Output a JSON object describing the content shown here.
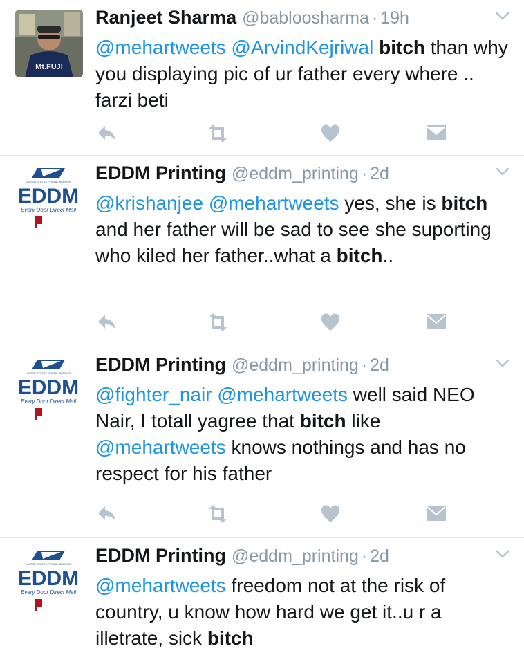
{
  "colors": {
    "mention": "#1b95e0",
    "meta": "#8899a6",
    "action_icon": "#b7c4d0",
    "divider": "#e1e8ed",
    "eddm_blue": "#1d4f91",
    "eddm_red": "#b0141c"
  },
  "eddm_logo": {
    "wordmark": "EDDM",
    "tagline": "Every Door Direct Mail",
    "usps": "UNITED STATES POSTAL SERVICE"
  },
  "tweets": [
    {
      "name": "Ranjeet Sharma",
      "handle": "@babloosharma",
      "dot": "·",
      "time": "19h",
      "avatar_caption": "Mt.FUJI",
      "segments": [
        {
          "t": "@mehartweets",
          "s": "mention"
        },
        {
          "t": " ",
          "s": ""
        },
        {
          "t": "@ArvindKejriwal",
          "s": "mention"
        },
        {
          "t": " ",
          "s": ""
        },
        {
          "t": "bitch",
          "s": "bold"
        },
        {
          "t": " than why you displaying pic of ur father every where .. farzi beti",
          "s": ""
        }
      ]
    },
    {
      "name": "EDDM Printing",
      "handle": "@eddm_printing",
      "dot": "·",
      "time": "2d",
      "segments": [
        {
          "t": "@krishanjee",
          "s": "mention"
        },
        {
          "t": " ",
          "s": ""
        },
        {
          "t": "@mehartweets",
          "s": "mention"
        },
        {
          "t": " yes, she is ",
          "s": ""
        },
        {
          "t": "bitch",
          "s": "bold"
        },
        {
          "t": " and her father will be sad to see she suporting who kiled her father..what a ",
          "s": ""
        },
        {
          "t": "bitch",
          "s": "bold"
        },
        {
          "t": "..",
          "s": ""
        }
      ]
    },
    {
      "name": "EDDM Printing",
      "handle": "@eddm_printing",
      "dot": "·",
      "time": "2d",
      "segments": [
        {
          "t": "@fighter_nair",
          "s": "mention"
        },
        {
          "t": " ",
          "s": ""
        },
        {
          "t": "@mehartweets",
          "s": "mention"
        },
        {
          "t": " well said NEO Nair, I totall yagree that ",
          "s": ""
        },
        {
          "t": "bitch",
          "s": "bold"
        },
        {
          "t": " like ",
          "s": ""
        },
        {
          "t": "@mehartweets",
          "s": "mention"
        },
        {
          "t": " knows nothings and has no respect for his father",
          "s": ""
        }
      ]
    },
    {
      "name": "EDDM Printing",
      "handle": "@eddm_printing",
      "dot": "·",
      "time": "2d",
      "segments": [
        {
          "t": "@mehartweets",
          "s": "mention"
        },
        {
          "t": " freedom not at the risk of country, u know how hard we get it..u r a illetrate, sick ",
          "s": ""
        },
        {
          "t": "bitch",
          "s": "bold"
        }
      ]
    }
  ]
}
